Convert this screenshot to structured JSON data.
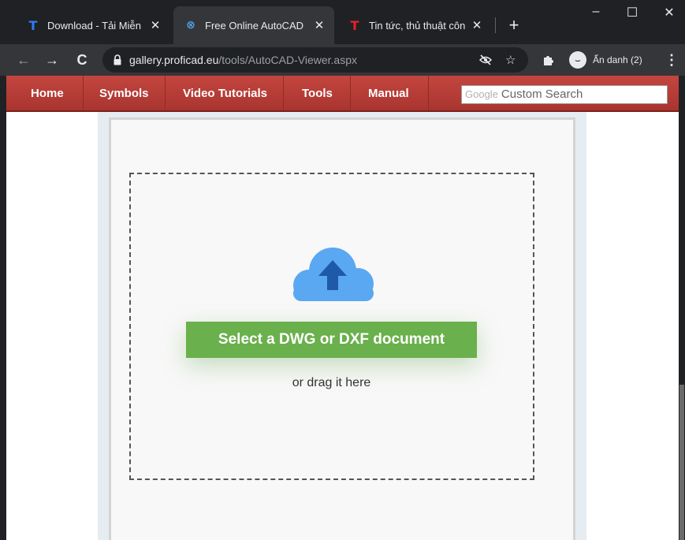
{
  "browser": {
    "tabs": [
      {
        "title": "Download - Tải Miễn",
        "favicon": "T",
        "favicon_color": "#2e7cf6",
        "active": false
      },
      {
        "title": "Free Online AutoCAD",
        "favicon": "⊗",
        "favicon_color": "#4fa3e8",
        "active": true
      },
      {
        "title": "Tin tức, thủ thuật côn",
        "favicon": "T",
        "favicon_color": "#e8202a",
        "active": false
      }
    ],
    "close_glyph": "✕",
    "new_tab_glyph": "+",
    "window_controls": {
      "minimize": "–",
      "maximize": "☐",
      "close": "✕"
    },
    "nav": {
      "back": "←",
      "forward": "→",
      "reload": "C"
    },
    "url": {
      "host": "gallery.proficad.eu",
      "path": "/tools/AutoCAD-Viewer.aspx"
    },
    "toolbar_icons": {
      "eye": "eye-off-icon",
      "star": "☆",
      "extensions": "puzzle-icon",
      "menu": "⋮"
    },
    "incognito_label": "Ẩn danh (2)"
  },
  "site": {
    "nav": [
      "Home",
      "Symbols",
      "Video Tutorials",
      "Tools",
      "Manual"
    ],
    "search": {
      "logo": "Google",
      "placeholder": "Custom Search"
    }
  },
  "viewer": {
    "button_label": "Select a DWG or DXF document",
    "drag_hint": "or drag it here",
    "button_color": "#6ab04c",
    "cloud_color": "#5aa7f2"
  }
}
